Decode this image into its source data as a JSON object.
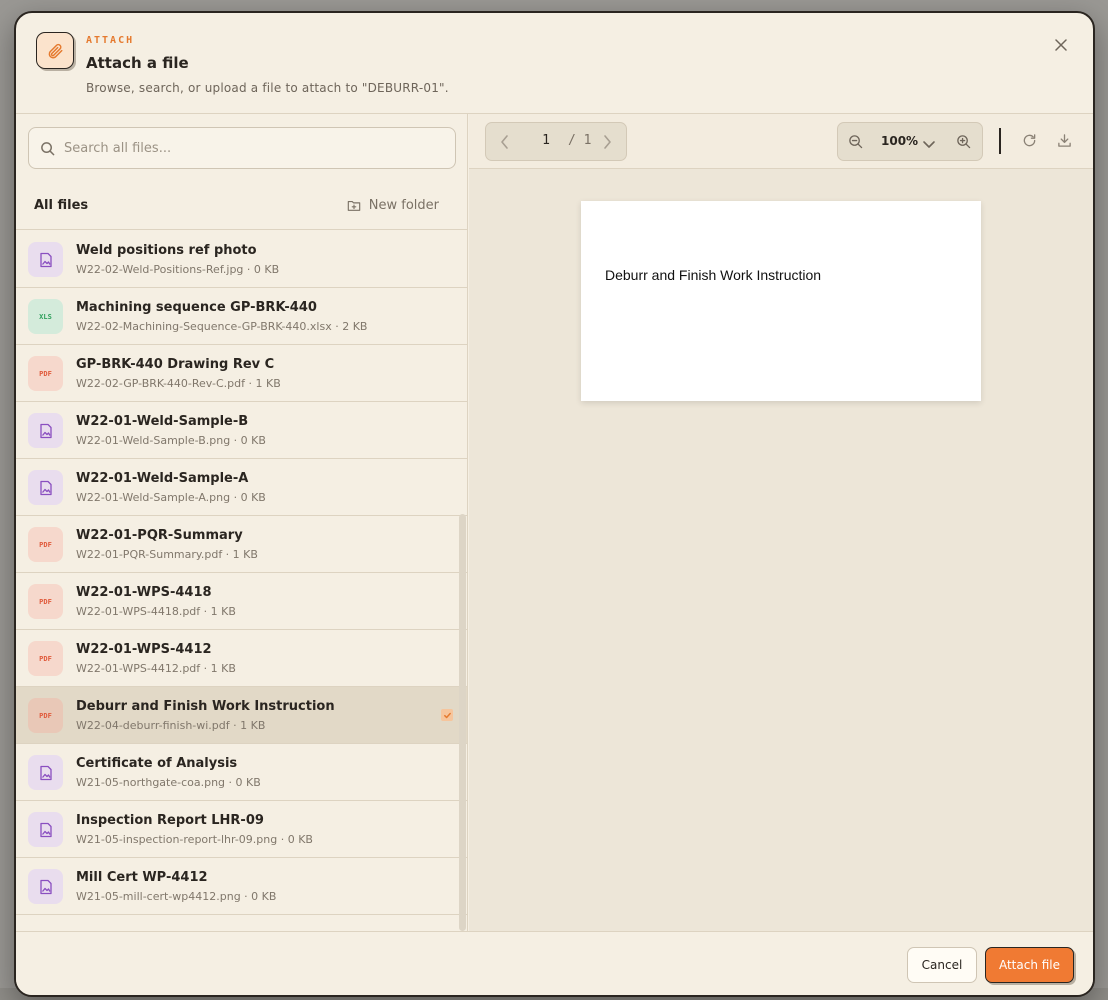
{
  "header": {
    "eyebrow": "ATTACH",
    "title": "Attach a file",
    "subtitle": "Browse, search, or upload a file to attach to \"DEBURR-01\"."
  },
  "search": {
    "placeholder": "Search all files..."
  },
  "browser": {
    "section_label": "All files",
    "new_folder_label": "New folder"
  },
  "files": [
    {
      "name": "Weld positions ref photo",
      "meta": "W22-02-Weld-Positions-Ref.jpg · 0 KB",
      "type": "img",
      "badge": "",
      "selected": false
    },
    {
      "name": "Machining sequence GP-BRK-440",
      "meta": "W22-02-Machining-Sequence-GP-BRK-440.xlsx · 2 KB",
      "type": "xls",
      "badge": "XLS",
      "selected": false
    },
    {
      "name": "GP-BRK-440 Drawing Rev C",
      "meta": "W22-02-GP-BRK-440-Rev-C.pdf · 1 KB",
      "type": "pdf",
      "badge": "PDF",
      "selected": false
    },
    {
      "name": "W22-01-Weld-Sample-B",
      "meta": "W22-01-Weld-Sample-B.png · 0 KB",
      "type": "img",
      "badge": "",
      "selected": false
    },
    {
      "name": "W22-01-Weld-Sample-A",
      "meta": "W22-01-Weld-Sample-A.png · 0 KB",
      "type": "img",
      "badge": "",
      "selected": false
    },
    {
      "name": "W22-01-PQR-Summary",
      "meta": "W22-01-PQR-Summary.pdf · 1 KB",
      "type": "pdf",
      "badge": "PDF",
      "selected": false
    },
    {
      "name": "W22-01-WPS-4418",
      "meta": "W22-01-WPS-4418.pdf · 1 KB",
      "type": "pdf",
      "badge": "PDF",
      "selected": false
    },
    {
      "name": "W22-01-WPS-4412",
      "meta": "W22-01-WPS-4412.pdf · 1 KB",
      "type": "pdf",
      "badge": "PDF",
      "selected": false
    },
    {
      "name": "Deburr and Finish Work Instruction",
      "meta": "W22-04-deburr-finish-wi.pdf · 1 KB",
      "type": "pdf",
      "badge": "PDF",
      "selected": true
    },
    {
      "name": "Certificate of Analysis",
      "meta": "W21-05-northgate-coa.png · 0 KB",
      "type": "img",
      "badge": "",
      "selected": false
    },
    {
      "name": "Inspection Report LHR-09",
      "meta": "W21-05-inspection-report-lhr-09.png · 0 KB",
      "type": "img",
      "badge": "",
      "selected": false
    },
    {
      "name": "Mill Cert WP-4412",
      "meta": "W21-05-mill-cert-wp4412.png · 0 KB",
      "type": "img",
      "badge": "",
      "selected": false
    }
  ],
  "viewer": {
    "page_current": "1",
    "page_total": "/ 1",
    "zoom": "100%",
    "document_text": "Deburr and Finish Work Instruction"
  },
  "footer": {
    "cancel_label": "Cancel",
    "attach_label": "Attach file"
  },
  "colors": {
    "accent": "#f07a33",
    "pdf": "#e0593a",
    "xls": "#2f9f5c",
    "image": "#8a4fc0"
  }
}
